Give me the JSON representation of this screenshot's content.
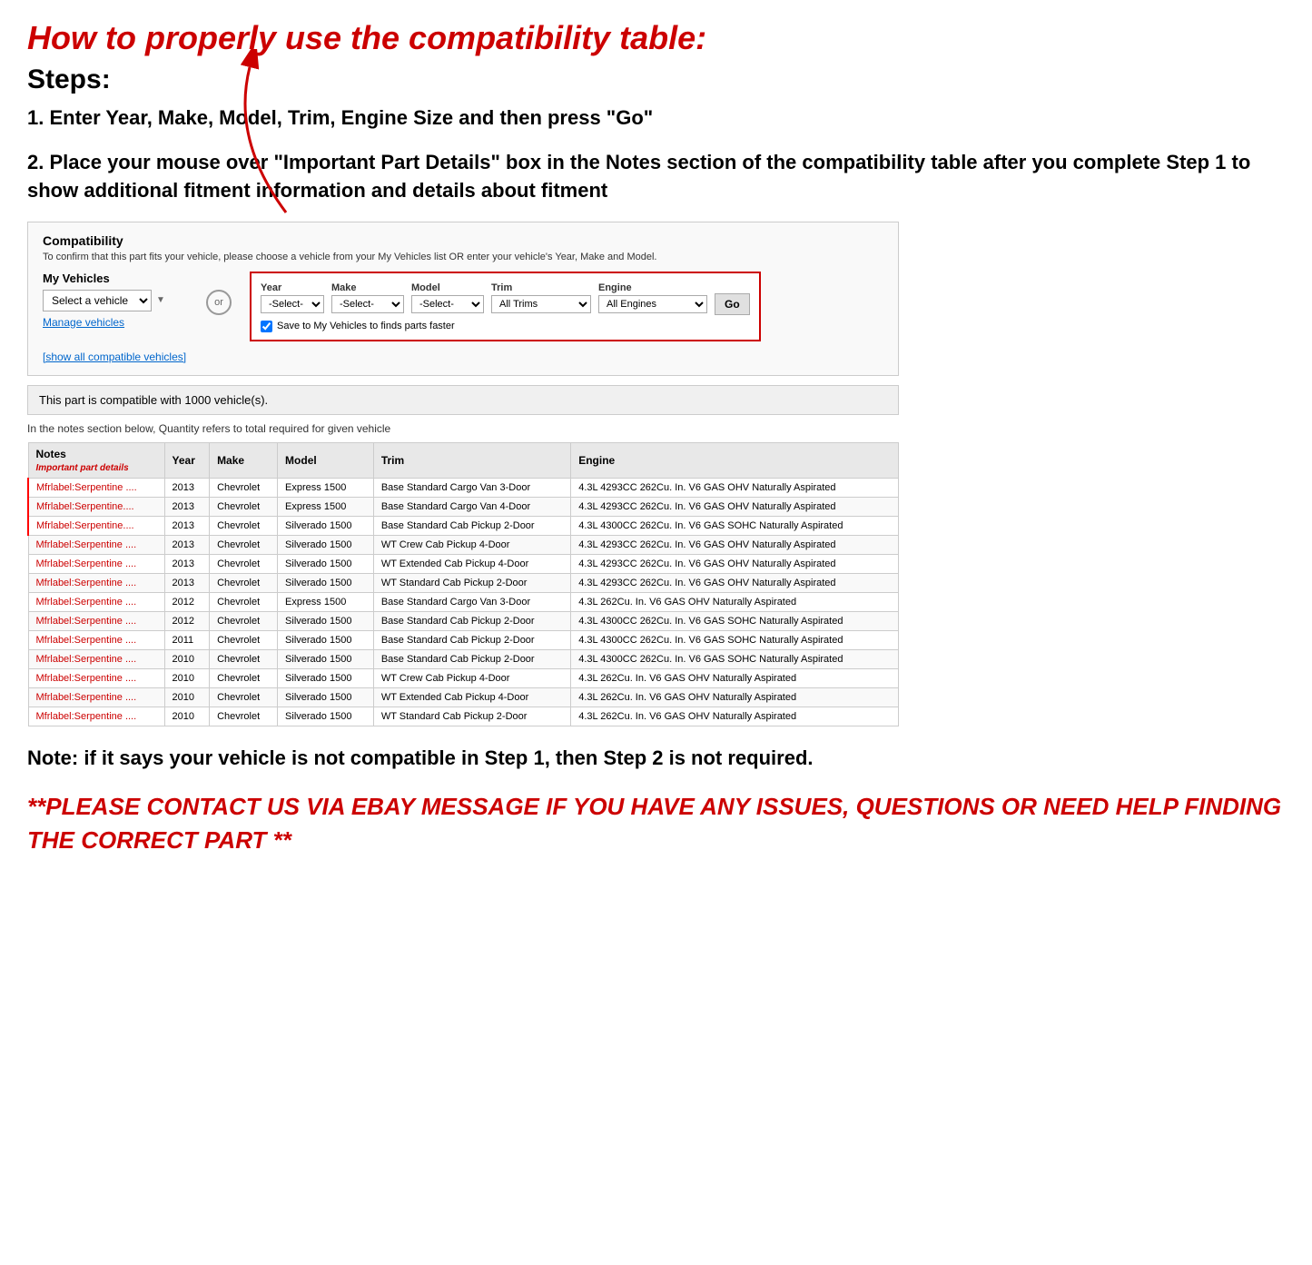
{
  "header": {
    "main_title": "How to properly use the compatibility table:",
    "steps_title": "Steps:",
    "step1": "1. Enter Year, Make, Model, Trim, Engine Size and then press \"Go\"",
    "step2": "2. Place your mouse over \"Important Part Details\" box in the Notes section of the compatibility table after you complete Step 1 to show additional fitment information and details about fitment"
  },
  "compatibility_widget": {
    "title": "Compatibility",
    "subtitle": "To confirm that this part fits your vehicle, please choose a vehicle from your My Vehicles list OR enter your vehicle's Year, Make and Model.",
    "my_vehicles_label": "My Vehicles",
    "select_vehicle_placeholder": "Select a vehicle",
    "manage_vehicles_link": "Manage vehicles",
    "show_all_link": "[show all compatible vehicles]",
    "or_label": "or",
    "year_label": "Year",
    "year_placeholder": "-Select-",
    "make_label": "Make",
    "make_placeholder": "-Select-",
    "model_label": "Model",
    "model_placeholder": "-Select-",
    "trim_label": "Trim",
    "trim_value": "All Trims",
    "engine_label": "Engine",
    "engine_value": "All Engines",
    "go_button": "Go",
    "save_checkbox_label": "Save to My Vehicles to finds parts faster"
  },
  "compatible_banner": "This part is compatible with 1000 vehicle(s).",
  "quantity_note": "In the notes section below, Quantity refers to total required for given vehicle",
  "table": {
    "headers": [
      "Notes",
      "Year",
      "Make",
      "Model",
      "Trim",
      "Engine"
    ],
    "notes_subheader": "Important part details",
    "rows": [
      {
        "notes": "Mfrlabel:Serpentine ....",
        "year": "2013",
        "make": "Chevrolet",
        "model": "Express 1500",
        "trim": "Base Standard Cargo Van 3-Door",
        "engine": "4.3L 4293CC 262Cu. In. V6 GAS OHV Naturally Aspirated"
      },
      {
        "notes": "Mfrlabel:Serpentine....",
        "year": "2013",
        "make": "Chevrolet",
        "model": "Express 1500",
        "trim": "Base Standard Cargo Van 4-Door",
        "engine": "4.3L 4293CC 262Cu. In. V6 GAS OHV Naturally Aspirated"
      },
      {
        "notes": "Mfrlabel:Serpentine....",
        "year": "2013",
        "make": "Chevrolet",
        "model": "Silverado 1500",
        "trim": "Base Standard Cab Pickup 2-Door",
        "engine": "4.3L 4300CC 262Cu. In. V6 GAS SOHC Naturally Aspirated"
      },
      {
        "notes": "Mfrlabel:Serpentine ....",
        "year": "2013",
        "make": "Chevrolet",
        "model": "Silverado 1500",
        "trim": "WT Crew Cab Pickup 4-Door",
        "engine": "4.3L 4293CC 262Cu. In. V6 GAS OHV Naturally Aspirated"
      },
      {
        "notes": "Mfrlabel:Serpentine ....",
        "year": "2013",
        "make": "Chevrolet",
        "model": "Silverado 1500",
        "trim": "WT Extended Cab Pickup 4-Door",
        "engine": "4.3L 4293CC 262Cu. In. V6 GAS OHV Naturally Aspirated"
      },
      {
        "notes": "Mfrlabel:Serpentine ....",
        "year": "2013",
        "make": "Chevrolet",
        "model": "Silverado 1500",
        "trim": "WT Standard Cab Pickup 2-Door",
        "engine": "4.3L 4293CC 262Cu. In. V6 GAS OHV Naturally Aspirated"
      },
      {
        "notes": "Mfrlabel:Serpentine ....",
        "year": "2012",
        "make": "Chevrolet",
        "model": "Express 1500",
        "trim": "Base Standard Cargo Van 3-Door",
        "engine": "4.3L 262Cu. In. V6 GAS OHV Naturally Aspirated"
      },
      {
        "notes": "Mfrlabel:Serpentine ....",
        "year": "2012",
        "make": "Chevrolet",
        "model": "Silverado 1500",
        "trim": "Base Standard Cab Pickup 2-Door",
        "engine": "4.3L 4300CC 262Cu. In. V6 GAS SOHC Naturally Aspirated"
      },
      {
        "notes": "Mfrlabel:Serpentine ....",
        "year": "2011",
        "make": "Chevrolet",
        "model": "Silverado 1500",
        "trim": "Base Standard Cab Pickup 2-Door",
        "engine": "4.3L 4300CC 262Cu. In. V6 GAS SOHC Naturally Aspirated"
      },
      {
        "notes": "Mfrlabel:Serpentine ....",
        "year": "2010",
        "make": "Chevrolet",
        "model": "Silverado 1500",
        "trim": "Base Standard Cab Pickup 2-Door",
        "engine": "4.3L 4300CC 262Cu. In. V6 GAS SOHC Naturally Aspirated"
      },
      {
        "notes": "Mfrlabel:Serpentine ....",
        "year": "2010",
        "make": "Chevrolet",
        "model": "Silverado 1500",
        "trim": "WT Crew Cab Pickup 4-Door",
        "engine": "4.3L 262Cu. In. V6 GAS OHV Naturally Aspirated"
      },
      {
        "notes": "Mfrlabel:Serpentine ....",
        "year": "2010",
        "make": "Chevrolet",
        "model": "Silverado 1500",
        "trim": "WT Extended Cab Pickup 4-Door",
        "engine": "4.3L 262Cu. In. V6 GAS OHV Naturally Aspirated"
      },
      {
        "notes": "Mfrlabel:Serpentine ....",
        "year": "2010",
        "make": "Chevrolet",
        "model": "Silverado 1500",
        "trim": "WT Standard Cab Pickup 2-Door",
        "engine": "4.3L 262Cu. In. V6 GAS OHV Naturally Aspirated"
      }
    ]
  },
  "footer": {
    "note": "Note: if it says your vehicle is not compatible in Step 1, then Step 2 is not required.",
    "contact": "**PLEASE CONTACT US VIA EBAY MESSAGE IF YOU HAVE ANY ISSUES, QUESTIONS OR NEED HELP FINDING THE CORRECT PART **"
  }
}
